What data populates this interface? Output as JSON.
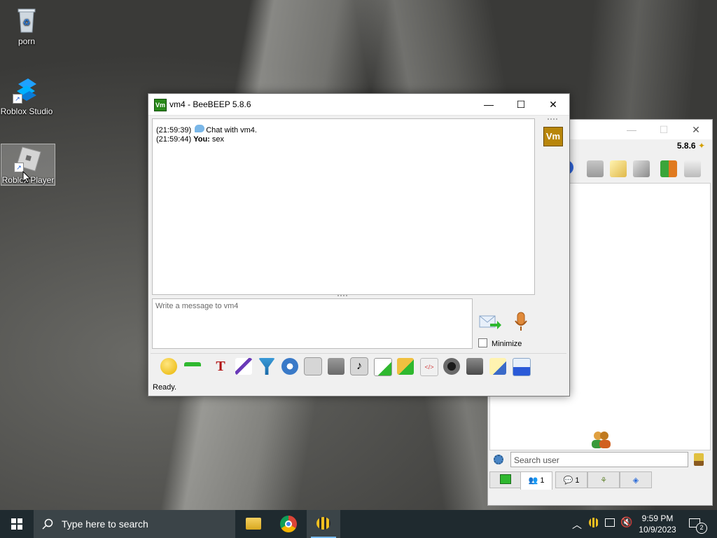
{
  "desktop": {
    "icons": [
      {
        "label": "porn"
      },
      {
        "label": "Roblox Studio"
      },
      {
        "label": "Roblox Player"
      }
    ]
  },
  "back_window": {
    "version": "5.8.6",
    "search_placeholder": "Search user",
    "tabs": [
      {
        "label": ""
      },
      {
        "label": "1"
      },
      {
        "label": "1"
      },
      {
        "label": ""
      },
      {
        "label": ""
      }
    ]
  },
  "chat_window": {
    "badge": "Vm",
    "title": "vm4 - BeeBEEP 5.8.6",
    "messages": [
      {
        "time": "(21:59:39)",
        "author": "",
        "text": "Chat with vm4."
      },
      {
        "time": "(21:59:44)",
        "author": "You:",
        "text": "sex"
      }
    ],
    "avatar": "Vm",
    "input_placeholder": "Write a message to vm4",
    "minimize_label": "Minimize",
    "status": "Ready."
  },
  "taskbar": {
    "search_placeholder": "Type here to search",
    "time": "9:59 PM",
    "date": "10/9/2023",
    "notification_count": "2"
  },
  "colors": {
    "taskbar": "#1f2a2f",
    "accent": "#76b9ed",
    "badge_green": "#2a8a1a",
    "avatar_gold": "#b8860b"
  }
}
